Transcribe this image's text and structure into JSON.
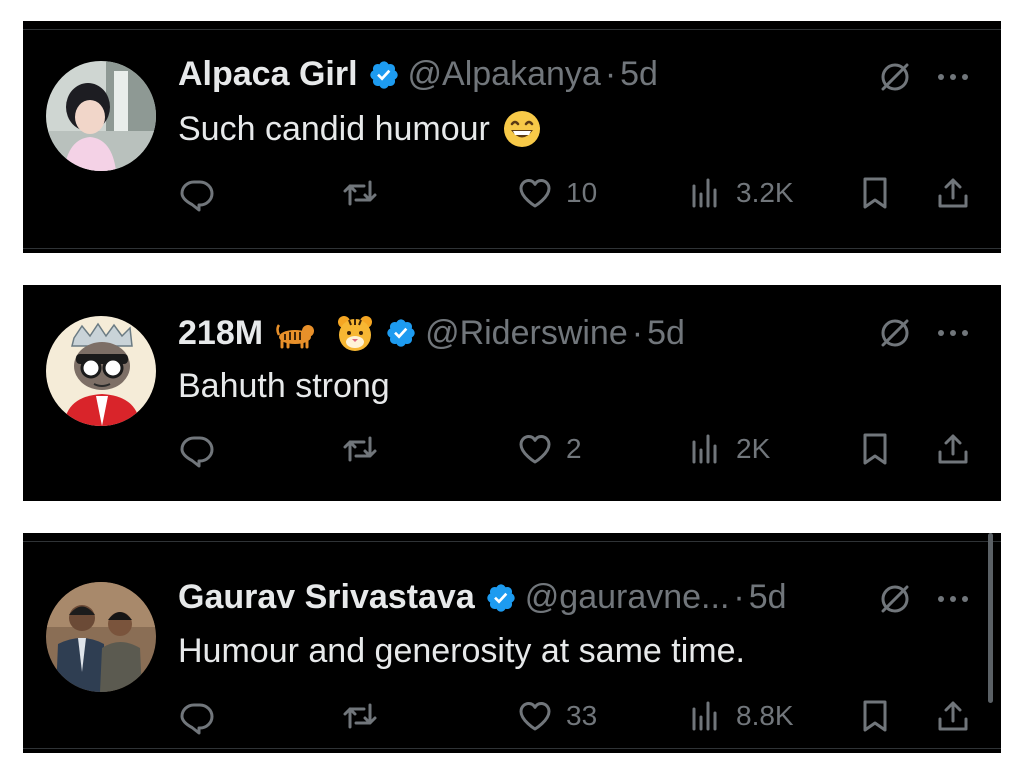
{
  "tweets": [
    {
      "name": "Alpaca Girl",
      "handle": "@Alpakanya",
      "dot": "·",
      "time": "5d",
      "text": "Such candid humour",
      "verified": true,
      "emoji_icon": "grinning-face-emoji",
      "avatar_icon": "avatar-girl-photo",
      "likes": "10",
      "views": "3.2K"
    },
    {
      "name": "218M",
      "handle": "@Riderswine",
      "dot": "·",
      "time": "5d",
      "text": "Bahuth strong",
      "verified": true,
      "name_emojis": [
        "tiger-emoji",
        "tiger-face-emoji"
      ],
      "avatar_icon": "avatar-cartoon-ape",
      "likes": "2",
      "views": "2K"
    },
    {
      "name": "Gaurav Srivastava",
      "handle": "@gauravne...",
      "dot": "·",
      "time": "5d",
      "text": "Humour and generosity at same time.",
      "verified": true,
      "avatar_icon": "avatar-two-men-photo",
      "likes": "33",
      "views": "8.8K"
    }
  ],
  "colors": {
    "background": "#000000",
    "page": "#ffffff",
    "text": "#e7e9ea",
    "muted": "#71767b",
    "verified": "#1d9bf0"
  }
}
